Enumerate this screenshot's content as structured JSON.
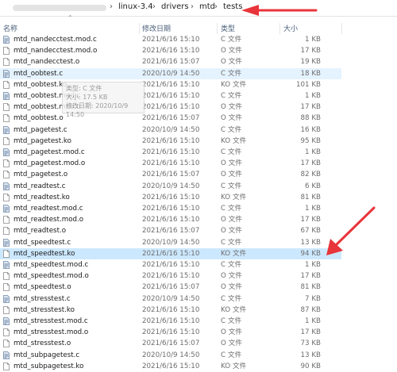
{
  "address": {
    "path": [
      "linux-3.4",
      "drivers",
      "mtd",
      "tests"
    ]
  },
  "columns": {
    "name": "名称",
    "modified": "修改日期",
    "type": "类型",
    "size": "大小"
  },
  "files": [
    {
      "name": "mtd_nandecctest.mod.c",
      "date": "2021/6/16 15:10",
      "type": "C 文件",
      "size": "1 KB",
      "icon": "c"
    },
    {
      "name": "mtd_nandecctest.mod.o",
      "date": "2021/6/16 15:10",
      "type": "O 文件",
      "size": "17 KB",
      "icon": "o"
    },
    {
      "name": "mtd_nandecctest.o",
      "date": "2021/6/16 15:07",
      "type": "O 文件",
      "size": "19 KB",
      "icon": "o"
    },
    {
      "name": "mtd_oobtest.c",
      "date": "2020/10/9 14:50",
      "type": "C 文件",
      "size": "18 KB",
      "icon": "c"
    },
    {
      "name": "mtd_oobtest.ko",
      "date": "2021/6/16 15:10",
      "type": "KO 文件",
      "size": "101 KB",
      "icon": "o"
    },
    {
      "name": "mtd_oobtest.mod.c",
      "date": "2021/6/16 15:10",
      "type": "C 文件",
      "size": "1 KB",
      "icon": "c"
    },
    {
      "name": "mtd_oobtest.mod.o",
      "date": "2021/6/16 15:10",
      "type": "O 文件",
      "size": "17 KB",
      "icon": "o"
    },
    {
      "name": "mtd_oobtest.o",
      "date": "2021/6/16 15:07",
      "type": "O 文件",
      "size": "88 KB",
      "icon": "o"
    },
    {
      "name": "mtd_pagetest.c",
      "date": "2020/10/9 14:50",
      "type": "C 文件",
      "size": "16 KB",
      "icon": "c"
    },
    {
      "name": "mtd_pagetest.ko",
      "date": "2021/6/16 15:10",
      "type": "KO 文件",
      "size": "95 KB",
      "icon": "o"
    },
    {
      "name": "mtd_pagetest.mod.c",
      "date": "2021/6/16 15:10",
      "type": "C 文件",
      "size": "1 KB",
      "icon": "c"
    },
    {
      "name": "mtd_pagetest.mod.o",
      "date": "2021/6/16 15:10",
      "type": "O 文件",
      "size": "17 KB",
      "icon": "o"
    },
    {
      "name": "mtd_pagetest.o",
      "date": "2021/6/16 15:07",
      "type": "O 文件",
      "size": "82 KB",
      "icon": "o"
    },
    {
      "name": "mtd_readtest.c",
      "date": "2020/10/9 14:50",
      "type": "C 文件",
      "size": "6 KB",
      "icon": "c"
    },
    {
      "name": "mtd_readtest.ko",
      "date": "2021/6/16 15:10",
      "type": "KO 文件",
      "size": "81 KB",
      "icon": "o"
    },
    {
      "name": "mtd_readtest.mod.c",
      "date": "2021/6/16 15:10",
      "type": "C 文件",
      "size": "1 KB",
      "icon": "c"
    },
    {
      "name": "mtd_readtest.mod.o",
      "date": "2021/6/16 15:10",
      "type": "O 文件",
      "size": "17 KB",
      "icon": "o"
    },
    {
      "name": "mtd_readtest.o",
      "date": "2021/6/16 15:07",
      "type": "O 文件",
      "size": "67 KB",
      "icon": "o"
    },
    {
      "name": "mtd_speedtest.c",
      "date": "2020/10/9 14:50",
      "type": "C 文件",
      "size": "13 KB",
      "icon": "c"
    },
    {
      "name": "mtd_speedtest.ko",
      "date": "2021/6/16 15:10",
      "type": "KO 文件",
      "size": "94 KB",
      "icon": "o",
      "selected": true
    },
    {
      "name": "mtd_speedtest.mod.c",
      "date": "2021/6/16 15:10",
      "type": "C 文件",
      "size": "1 KB",
      "icon": "c"
    },
    {
      "name": "mtd_speedtest.mod.o",
      "date": "2021/6/16 15:10",
      "type": "O 文件",
      "size": "17 KB",
      "icon": "o"
    },
    {
      "name": "mtd_speedtest.o",
      "date": "2021/6/16 15:07",
      "type": "O 文件",
      "size": "81 KB",
      "icon": "o"
    },
    {
      "name": "mtd_stresstest.c",
      "date": "2020/10/9 14:50",
      "type": "C 文件",
      "size": "7 KB",
      "icon": "c"
    },
    {
      "name": "mtd_stresstest.ko",
      "date": "2021/6/16 15:10",
      "type": "KO 文件",
      "size": "87 KB",
      "icon": "o"
    },
    {
      "name": "mtd_stresstest.mod.c",
      "date": "2021/6/16 15:10",
      "type": "C 文件",
      "size": "1 KB",
      "icon": "c"
    },
    {
      "name": "mtd_stresstest.mod.o",
      "date": "2021/6/16 15:10",
      "type": "O 文件",
      "size": "17 KB",
      "icon": "o"
    },
    {
      "name": "mtd_stresstest.o",
      "date": "2021/6/16 15:07",
      "type": "O 文件",
      "size": "73 KB",
      "icon": "o"
    },
    {
      "name": "mtd_subpagetest.c",
      "date": "2020/10/9 14:50",
      "type": "C 文件",
      "size": "13 KB",
      "icon": "c"
    },
    {
      "name": "mtd_subpagetest.ko",
      "date": "2021/6/16 15:10",
      "type": "KO 文件",
      "size": "90 KB",
      "icon": "o"
    }
  ],
  "tooltip": {
    "lines": [
      "类型: C 文件",
      "大小: 17.5 KB",
      "修改日期: 2020/10/9 14:50"
    ]
  },
  "colors": {
    "selected_row": "#cce8ff",
    "hover_row": "#e5f3ff",
    "annotation_arrow": "#e8353b"
  },
  "icons": {
    "c_file": "c-source-file-icon",
    "o_file": "generic-file-icon",
    "chevron": "chevron-right-icon",
    "sort": "sort-ascending-icon"
  }
}
